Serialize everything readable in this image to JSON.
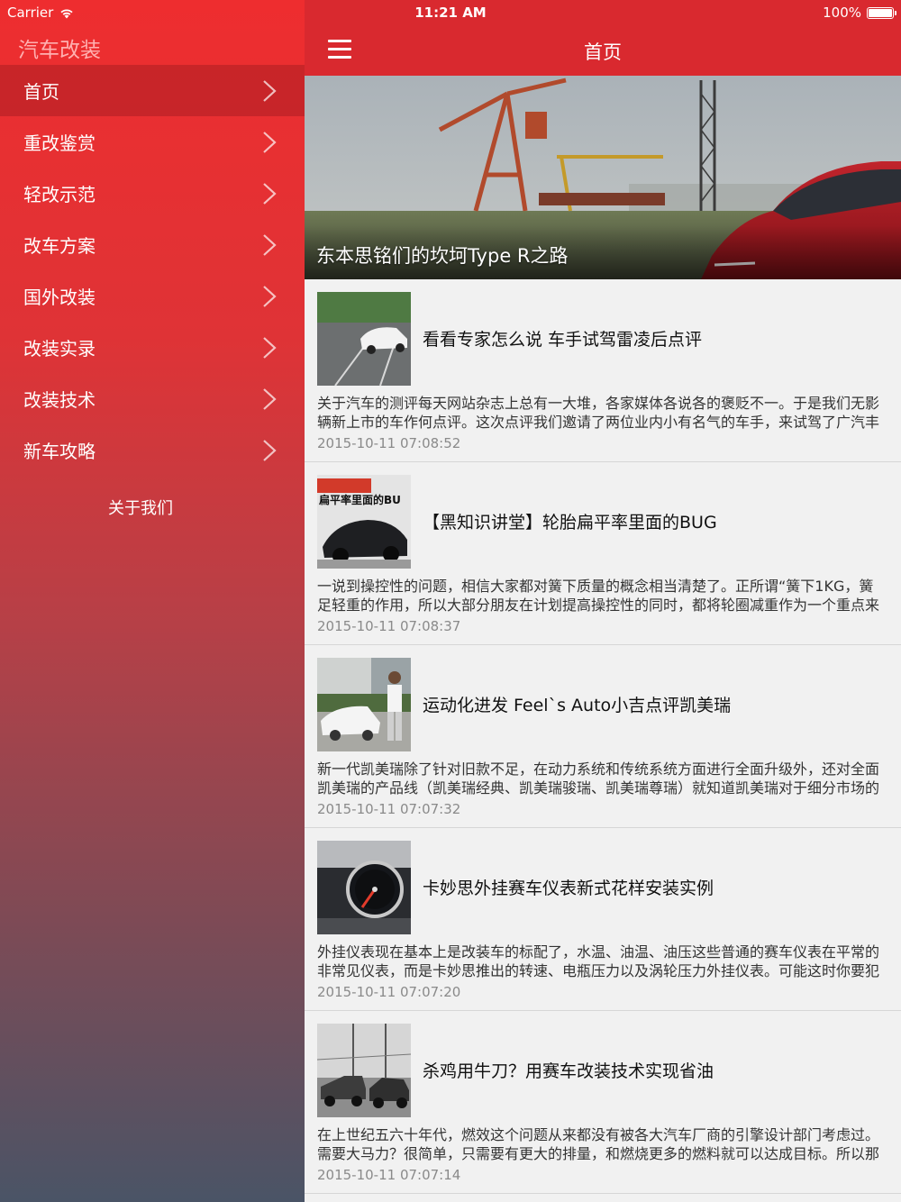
{
  "status_bar": {
    "carrier": "Carrier",
    "time": "11:21 AM",
    "battery": "100%"
  },
  "sidebar": {
    "title": "汽车改装",
    "items": [
      {
        "label": "首页",
        "active": true
      },
      {
        "label": "重改鉴赏"
      },
      {
        "label": "轻改示范"
      },
      {
        "label": "改车方案"
      },
      {
        "label": "国外改装"
      },
      {
        "label": "改装实录"
      },
      {
        "label": "改装技术"
      },
      {
        "label": "新车攻略"
      }
    ],
    "about": "关于我们"
  },
  "navbar": {
    "title": "首页"
  },
  "hero": {
    "caption": "东本思铭们的坎坷Type R之路"
  },
  "articles": [
    {
      "title": "看看专家怎么说 车手试驾雷凌后点评",
      "summary": [
        "关于汽车的测评每天网站杂志上总有一大堆，各家媒体各说各的褒贬不一。于是我们无影",
        "辆新上市的车作何点评。这次点评我们邀请了两位业内小有名气的车手，来试驾了广汽丰"
      ],
      "date": "2015-10-11 07:08:52"
    },
    {
      "title": "【黑知识讲堂】轮胎扁平率里面的BUG",
      "summary": [
        "一说到操控性的问题，相信大家都对簧下质量的概念相当清楚了。正所谓“簧下1KG，簧",
        "足轻重的作用，所以大部分朋友在计划提高操控性的同时，都将轮圈减重作为一个重点来"
      ],
      "date": "2015-10-11 07:08:37"
    },
    {
      "title": "运动化进发 Feel`s Auto小吉点评凯美瑞",
      "summary": [
        "新一代凯美瑞除了针对旧款不足，在动力系统和传统系统方面进行全面升级外，还对全面",
        "凯美瑞的产品线（凯美瑞经典、凯美瑞骏瑞、凯美瑞尊瑞）就知道凯美瑞对于细分市场的"
      ],
      "date": "2015-10-11 07:07:32"
    },
    {
      "title": "卡妙思外挂赛车仪表新式花样安装实例",
      "summary": [
        "外挂仪表现在基本上是改装车的标配了，水温、油温、油压这些普通的赛车仪表在平常的",
        "非常见仪表，而是卡妙思推出的转速、电瓶压力以及涡轮压力外挂仪表。可能这时你要犯"
      ],
      "date": "2015-10-11 07:07:20"
    },
    {
      "title": "杀鸡用牛刀？用赛车改装技术实现省油",
      "summary": [
        "在上世纪五六十年代，燃效这个问题从来都没有被各大汽车厂商的引擎设计部门考虑过。",
        "需要大马力？很简单，只需要有更大的排量，和燃烧更多的燃料就可以达成目标。所以那"
      ],
      "date": "2015-10-11 07:07:14"
    }
  ],
  "thumb2_overlay": "扁平率里面的BU"
}
